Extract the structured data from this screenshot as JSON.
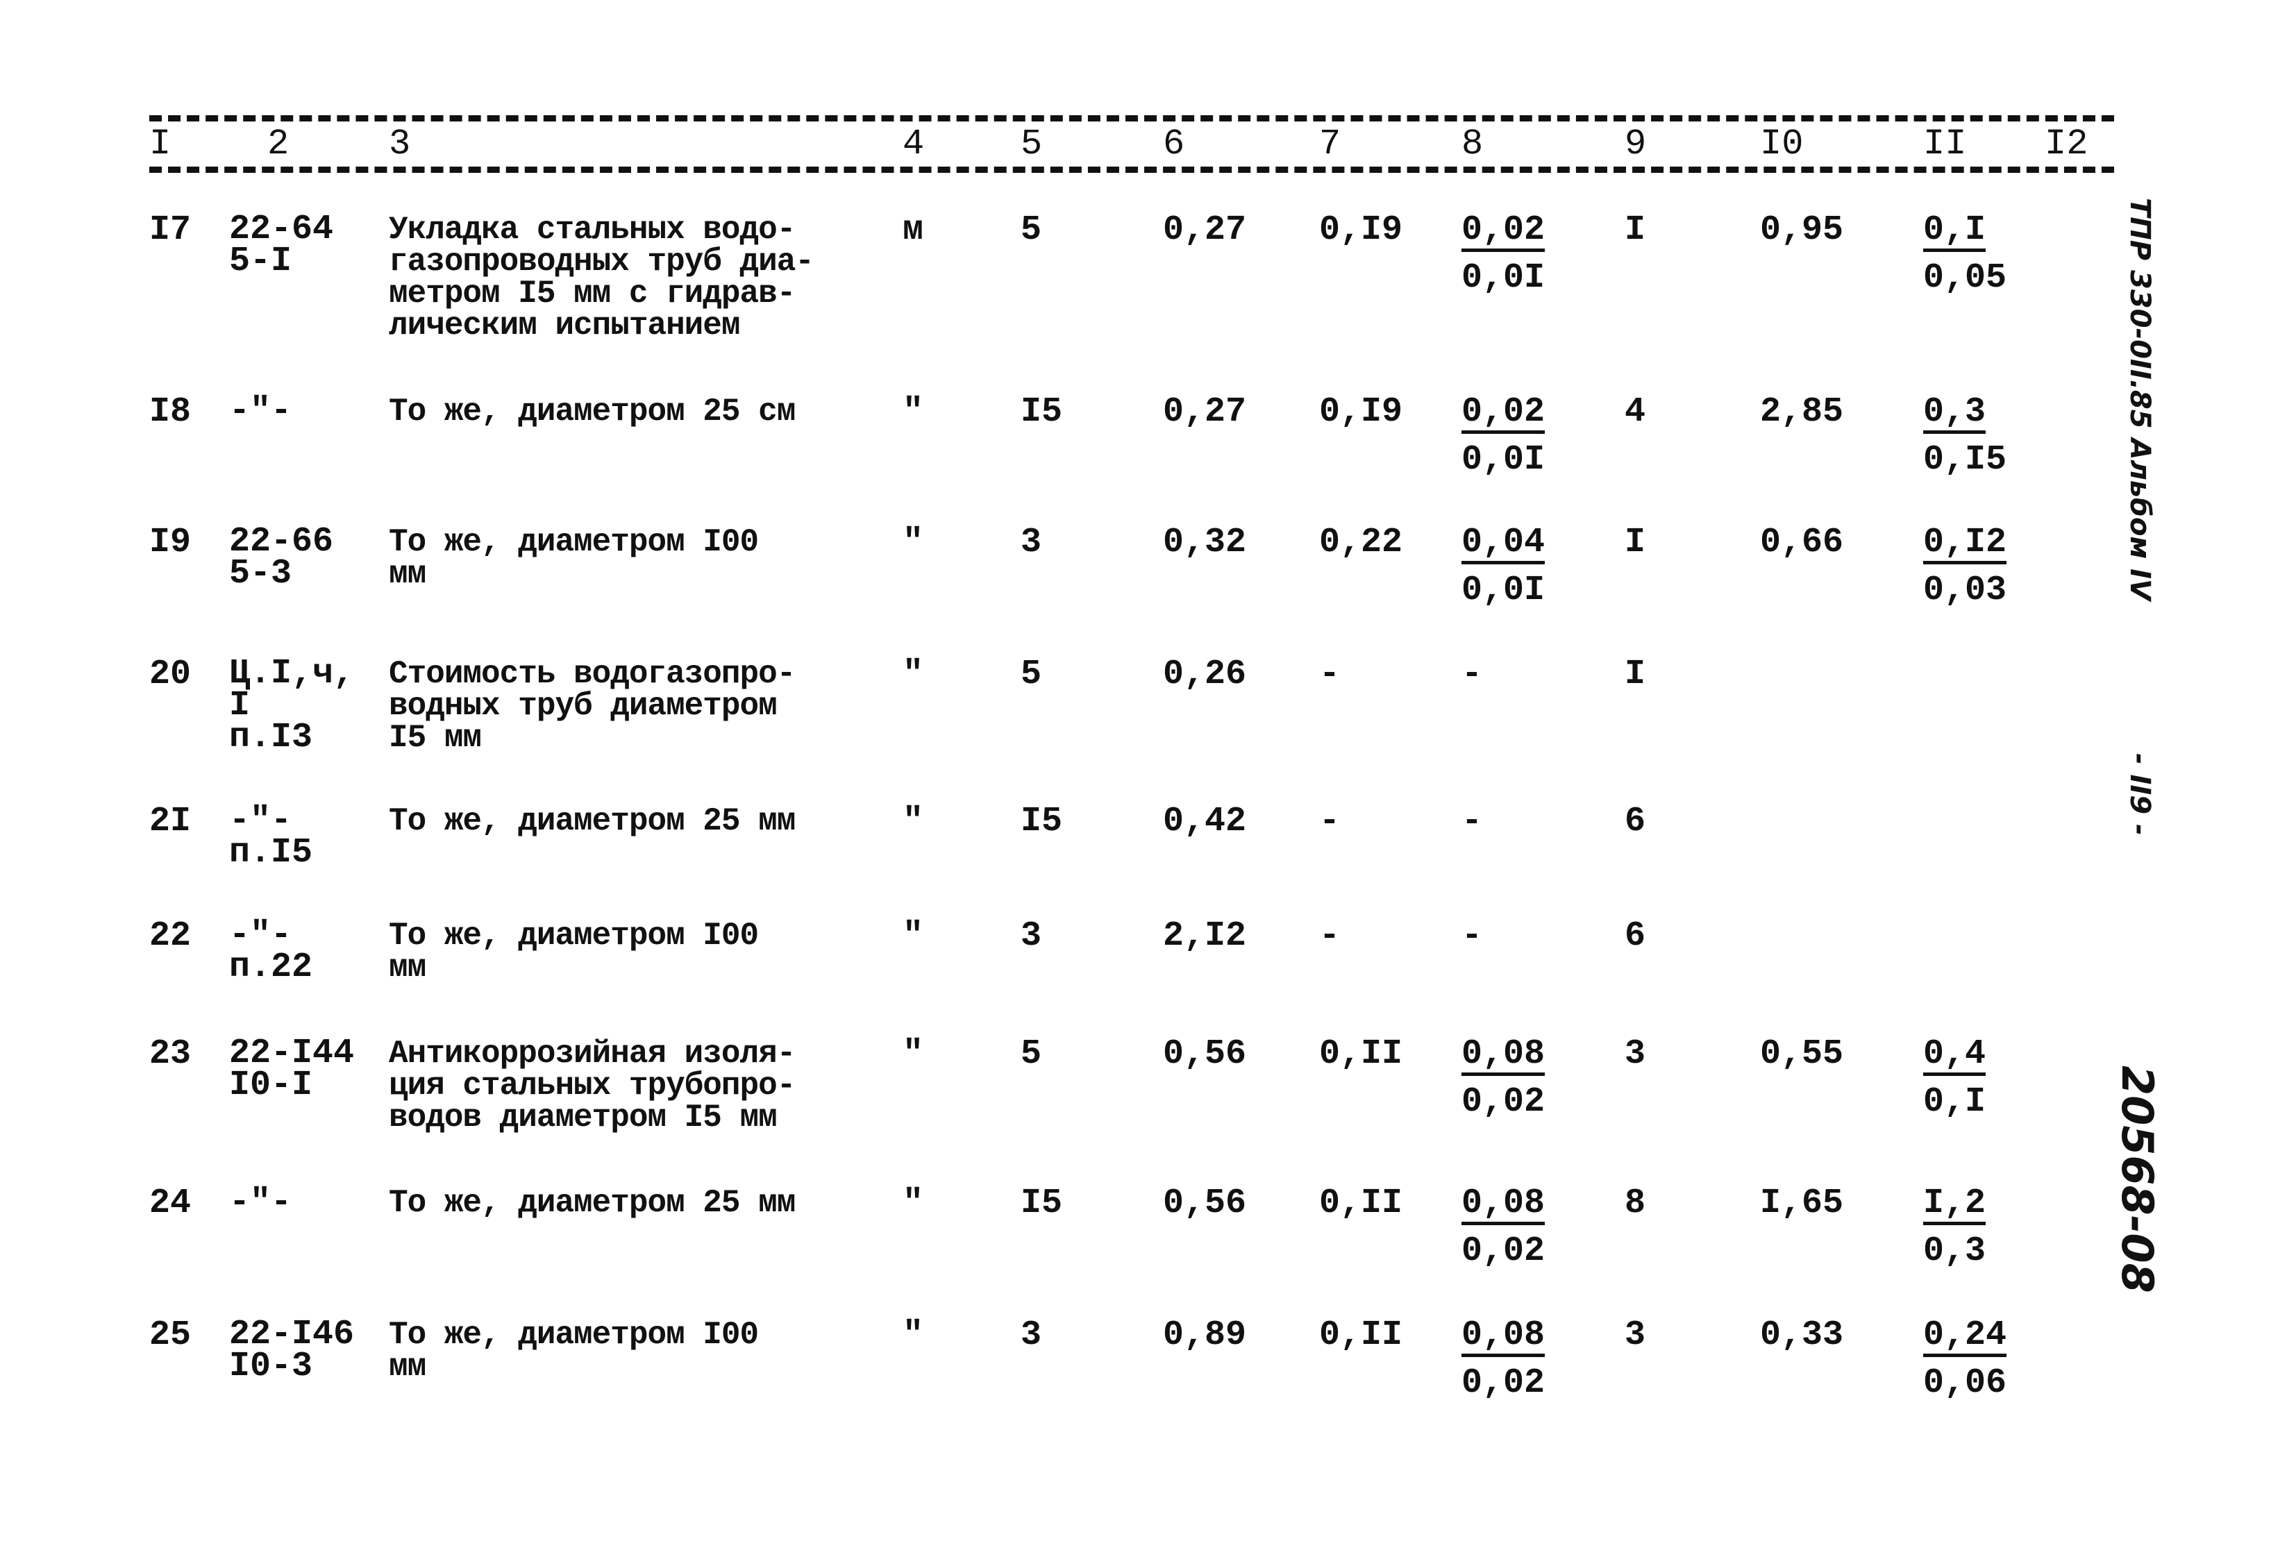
{
  "header": {
    "columns": [
      "I",
      "2",
      "3",
      "4",
      "5",
      "6",
      "7",
      "8",
      "9",
      "I0",
      "II",
      "I2"
    ]
  },
  "rows": [
    {
      "no": "I7",
      "code": "22-64\n5-I",
      "desc": "Укладка стальных водо-\nгазопроводных труб диа-\nметром I5 мм с гидрав-\nлическим испытанием",
      "unit": "м",
      "qty": "5",
      "c6": "0,27",
      "c7": "0,I9",
      "c8_num": "0,02",
      "c8_den": "0,0I",
      "c9": "I",
      "c10": "0,95",
      "c11_num": "0,I",
      "c11_den": "0,05"
    },
    {
      "no": "I8",
      "code": "-\"-",
      "desc": "То же, диаметром 25 см",
      "unit": "\"",
      "qty": "I5",
      "c6": "0,27",
      "c7": "0,I9",
      "c8_num": "0,02",
      "c8_den": "0,0I",
      "c9": "4",
      "c10": "2,85",
      "c11_num": "0,3",
      "c11_den": "0,I5"
    },
    {
      "no": "I9",
      "code": "22-66\n5-3",
      "desc": "То же, диаметром I00\nмм",
      "unit": "\"",
      "qty": "3",
      "c6": "0,32",
      "c7": "0,22",
      "c8_num": "0,04",
      "c8_den": "0,0I",
      "c9": "I",
      "c10": "0,66",
      "c11_num": "0,I2",
      "c11_den": "0,03"
    },
    {
      "no": "20",
      "code": "Ц.I,ч,\nI\nп.I3",
      "desc": "Стоимость водогазопро-\nводных труб диаметром\nI5 мм",
      "unit": "\"",
      "qty": "5",
      "c6": "0,26",
      "c7": "-",
      "c8": "-",
      "c9": "I",
      "c10": "",
      "c11": ""
    },
    {
      "no": "2I",
      "code": "-\"-\nп.I5",
      "desc": "То же, диаметром 25 мм",
      "unit": "\"",
      "qty": "I5",
      "c6": "0,42",
      "c7": "-",
      "c8": "-",
      "c9": "6",
      "c10": "",
      "c11": ""
    },
    {
      "no": "22",
      "code": "-\"-\nп.22",
      "desc": "То же, диаметром I00\nмм",
      "unit": "\"",
      "qty": "3",
      "c6": "2,I2",
      "c7": "-",
      "c8": "-",
      "c9": "6",
      "c10": "",
      "c11": ""
    },
    {
      "no": "23",
      "code": "22-I44\nI0-I",
      "desc": "Антикоррозийная изоля-\nция стальных трубопро-\nводов диаметром I5 мм",
      "unit": "\"",
      "qty": "5",
      "c6": "0,56",
      "c7": "0,II",
      "c8_num": "0,08",
      "c8_den": "0,02",
      "c9": "3",
      "c10": "0,55",
      "c11_num": "0,4",
      "c11_den": "0,I"
    },
    {
      "no": "24",
      "code": "-\"-",
      "desc": "То же, диаметром 25 мм",
      "unit": "\"",
      "qty": "I5",
      "c6": "0,56",
      "c7": "0,II",
      "c8_num": "0,08",
      "c8_den": "0,02",
      "c9": "8",
      "c10": "I,65",
      "c11_num": "I,2",
      "c11_den": "0,3"
    },
    {
      "no": "25",
      "code": "22-I46\nI0-3",
      "desc": "То же, диаметром I00\nмм",
      "unit": "\"",
      "qty": "3",
      "c6": "0,89",
      "c7": "0,II",
      "c8_num": "0,08",
      "c8_den": "0,02",
      "c9": "3",
      "c10": "0,33",
      "c11_num": "0,24",
      "c11_den": "0,06"
    }
  ],
  "margin": {
    "album_ref": "ТПР 330-0II.85  Альбом IV",
    "page_number": "- II9 -",
    "doc_number": "20568-08"
  }
}
